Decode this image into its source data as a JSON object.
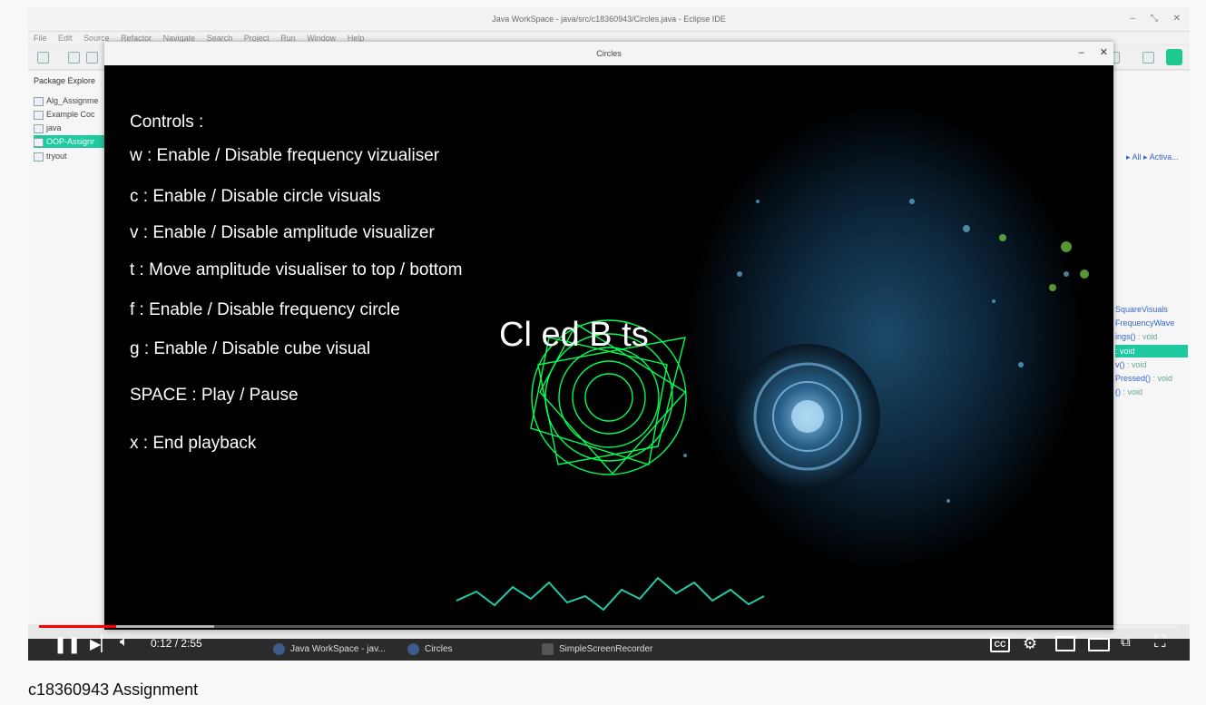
{
  "video": {
    "eclipse": {
      "title": "Java WorkSpace - java/src/c18360943/Circles.java - Eclipse IDE",
      "menu": [
        "File",
        "Edit",
        "Source",
        "Refactor",
        "Navigate",
        "Search",
        "Project",
        "Run",
        "Window",
        "Help"
      ],
      "package_explorer": {
        "title": "Package Explore",
        "items": [
          "Alg_Assignme",
          "Example Coc",
          "java",
          "OOP-Assignr",
          "tryout"
        ]
      },
      "outline": {
        "breadcrumb": [
          "All",
          "Activa..."
        ],
        "items": [
          {
            "label": "SquareVisuals",
            "type": ""
          },
          {
            "label": "FrequencyWave",
            "type": ""
          },
          {
            "label": "ings()",
            "type": ": void"
          },
          {
            "label": "",
            "type": ": void"
          },
          {
            "label": "v()",
            "type": ": void"
          },
          {
            "label": "Pressed()",
            "type": ": void"
          },
          {
            "label": "()",
            "type": ": void"
          }
        ]
      }
    },
    "circles_window": {
      "title": "Circles",
      "controls_heading": "Controls :",
      "controls": [
        "w : Enable / Disable frequency vizualiser",
        "c : Enable / Disable circle visuals",
        "v : Enable / Disable amplitude visualizer",
        "t : Move amplitude visualiser to top / bottom",
        "f : Enable / Disable frequency circle",
        "g : Enable / Disable cube visual",
        "SPACE : Play / Pause",
        "x : End playback"
      ],
      "overlay_text": "Cl   ed B   ts"
    },
    "taskbar": {
      "tasks": [
        "Java WorkSpace - jav...",
        "Circles",
        "SimpleScreenRecorder"
      ]
    },
    "player": {
      "time_current": "0:12",
      "time_total": "2:55",
      "time_separator": " / ",
      "progress_played": 0.068,
      "progress_buffered": 0.154,
      "cc_label": "CC"
    }
  },
  "caption": "c18360943 Assignment",
  "colors": {
    "accent": "#1ec9a0",
    "play_progress": "#ff0000",
    "green_vis": "#00ff55"
  }
}
